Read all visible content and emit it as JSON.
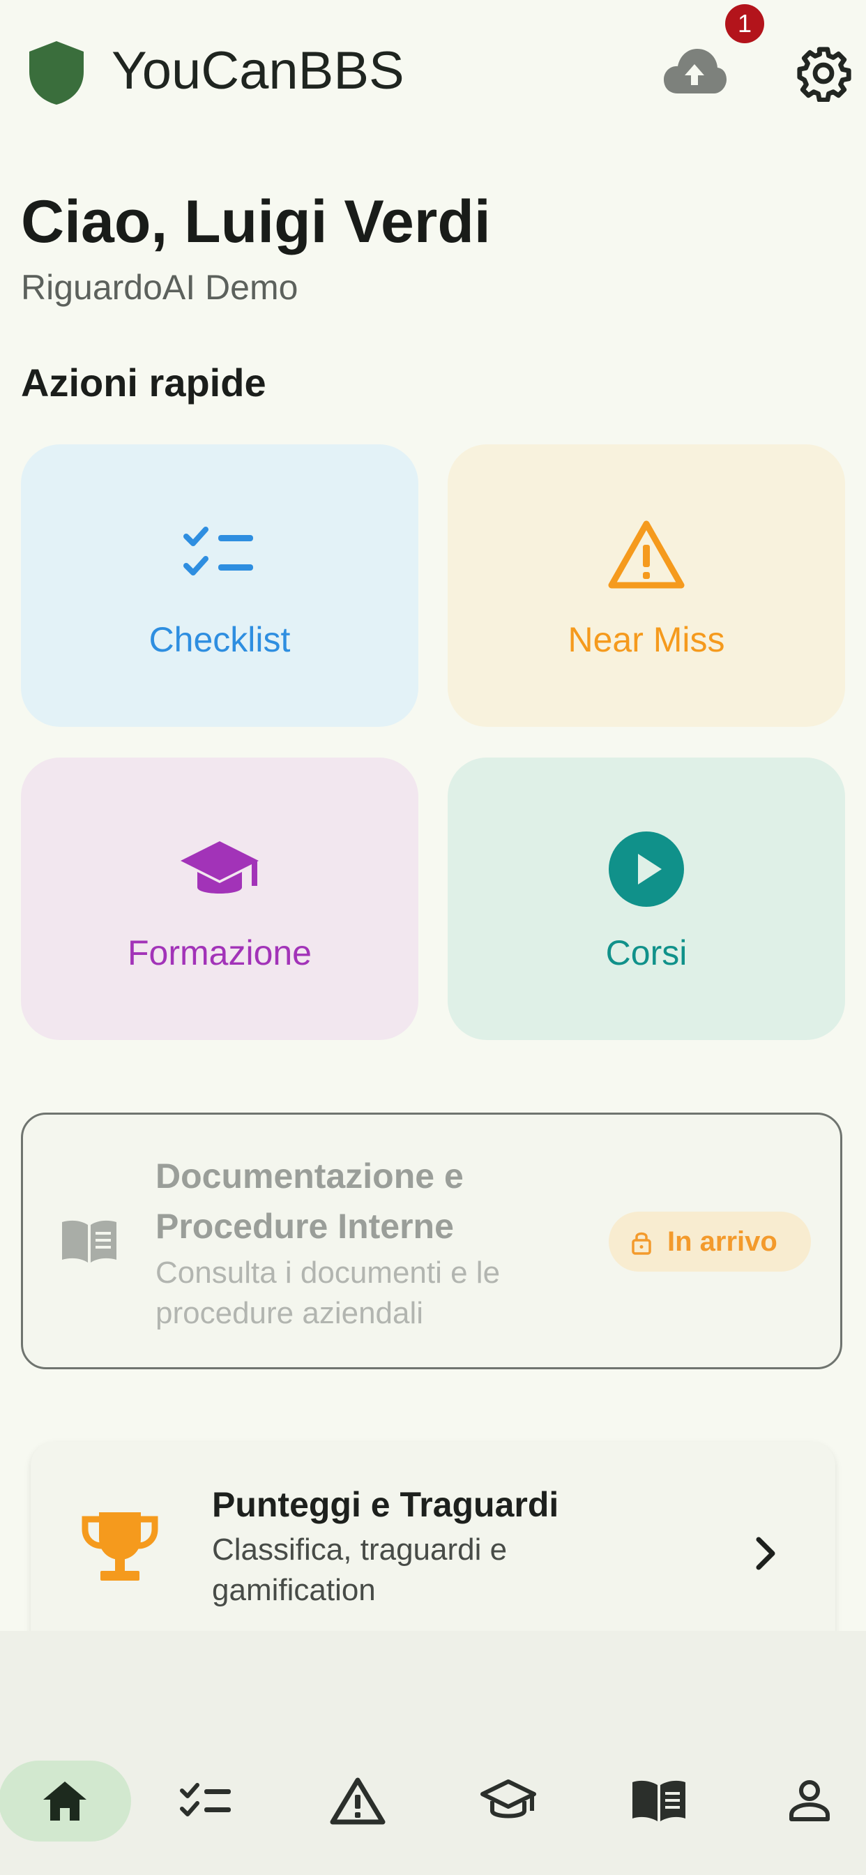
{
  "header": {
    "app_title": "YouCanBBS",
    "upload_badge": "1"
  },
  "greeting": "Ciao, Luigi Verdi",
  "organization": "RiguardoAI Demo",
  "quick_actions": {
    "title": "Azioni rapide",
    "items": [
      {
        "label": "Checklist",
        "color": "#2e8ee0"
      },
      {
        "label": "Near Miss",
        "color": "#f59a1d"
      },
      {
        "label": "Formazione",
        "color": "#a233b8"
      },
      {
        "label": "Corsi",
        "color": "#10918a"
      }
    ]
  },
  "documentation": {
    "title": "Documentazione e Procedure Interne",
    "subtitle": "Consulta i documenti e le procedure aziendali",
    "badge": "In arrivo"
  },
  "scores": {
    "title": "Punteggi e Traguardi",
    "subtitle": "Classifica, traguardi e gamification"
  },
  "bottom_nav": {
    "icons": [
      "home-icon",
      "checklist-icon",
      "warning-icon",
      "graduation-cap-icon",
      "book-icon",
      "person-icon"
    ]
  },
  "colors": {
    "brand_green": "#3a6e3c",
    "background": "#f7f9f1"
  }
}
